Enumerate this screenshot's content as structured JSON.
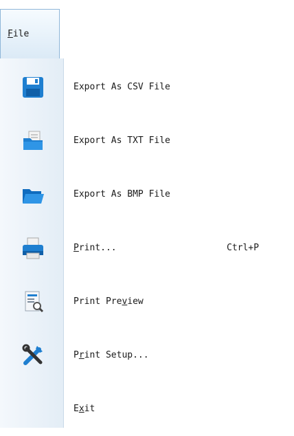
{
  "file_tab": {
    "label_pre": "",
    "label_mn": "F",
    "label_post": "ile"
  },
  "items": [
    {
      "id": "export-csv",
      "icon": "floppy-disk-icon",
      "pre": "Export As CSV File",
      "mn": "",
      "post": "",
      "shortcut": ""
    },
    {
      "id": "export-txt",
      "icon": "folder-documents-icon",
      "pre": "Export As TXT File",
      "mn": "",
      "post": "",
      "shortcut": ""
    },
    {
      "id": "export-bmp",
      "icon": "open-folder-icon",
      "pre": "Export As BMP File",
      "mn": "",
      "post": "",
      "shortcut": ""
    },
    {
      "id": "print",
      "icon": "printer-icon",
      "pre": "",
      "mn": "P",
      "post": "rint...",
      "shortcut": "Ctrl+P"
    },
    {
      "id": "print-preview",
      "icon": "print-preview-icon",
      "pre": "Print Pre",
      "mn": "v",
      "post": "iew",
      "shortcut": ""
    },
    {
      "id": "print-setup",
      "icon": "tools-icon",
      "pre": "P",
      "mn": "r",
      "post": "int Setup...",
      "shortcut": ""
    },
    {
      "id": "exit",
      "icon": "",
      "pre": "E",
      "mn": "x",
      "post": "it",
      "shortcut": ""
    }
  ],
  "colors": {
    "accent": "#1f8bd8",
    "gutter": "#e3edf6",
    "tab_border": "#8eb6d8"
  }
}
